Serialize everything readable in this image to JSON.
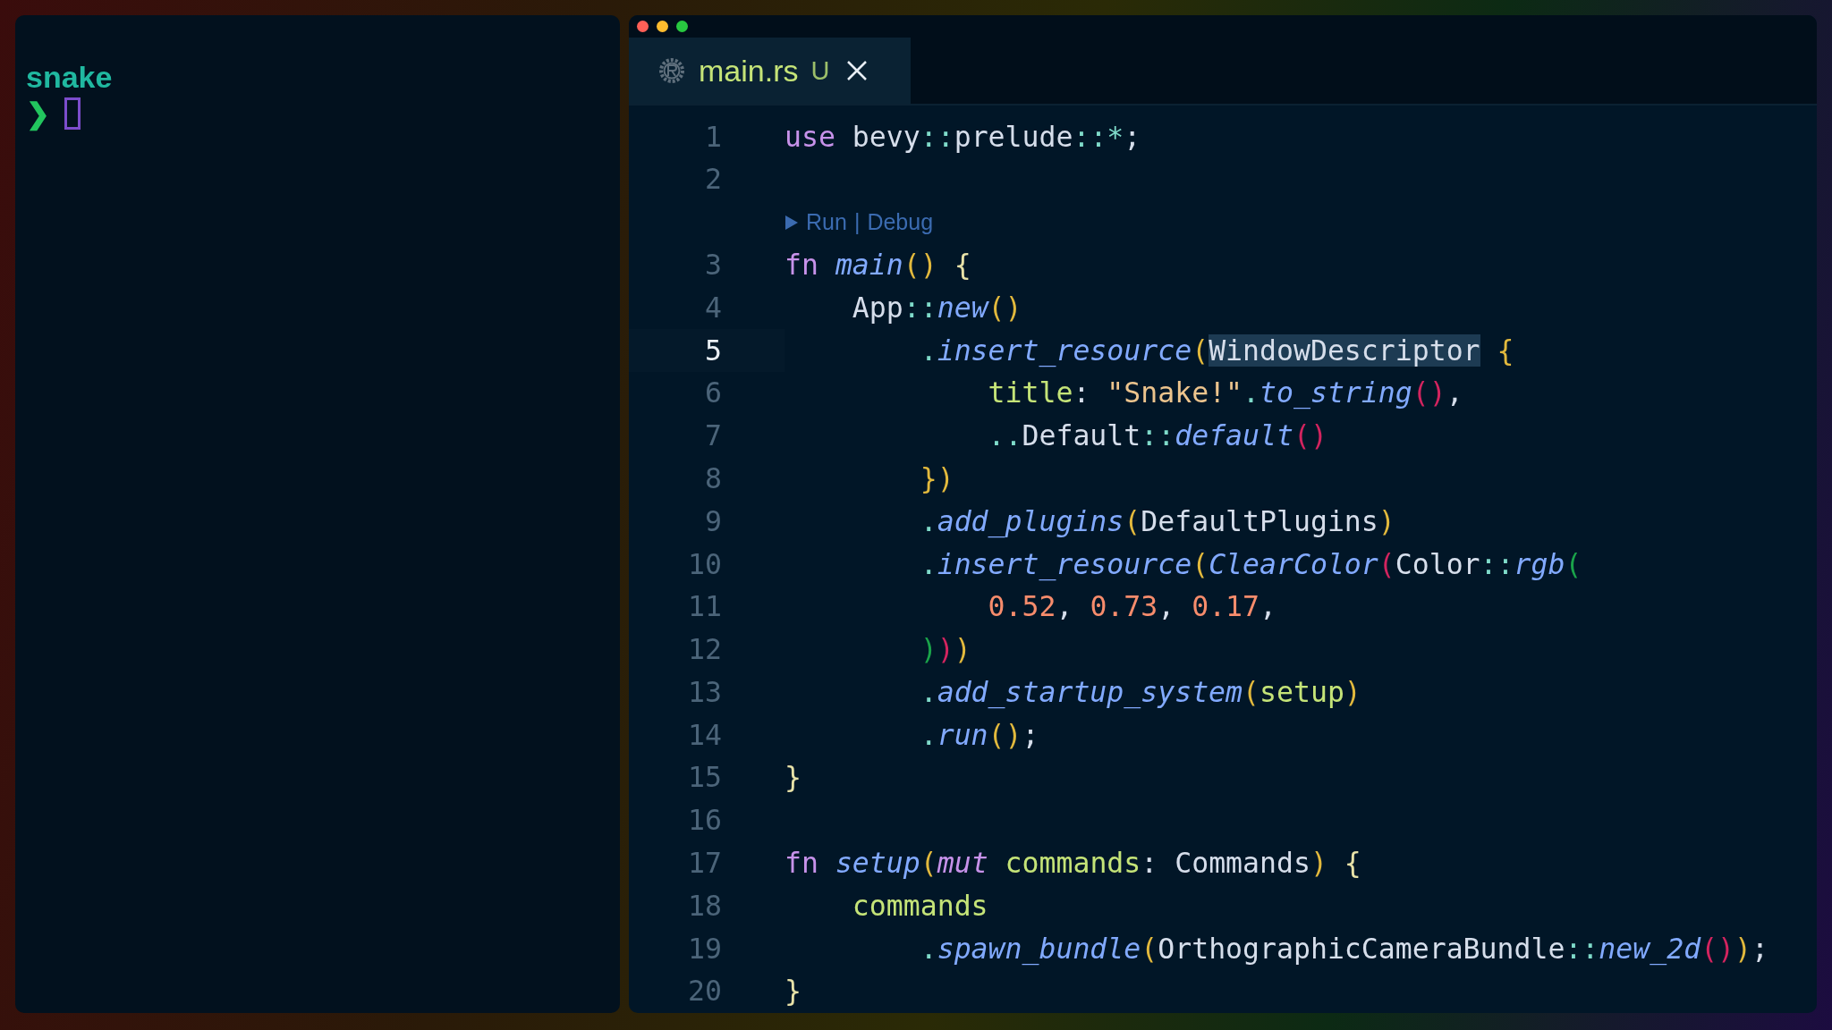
{
  "terminal": {
    "directory": "snake",
    "prompt": "❯"
  },
  "editor": {
    "tabs": [
      {
        "label": "main.rs",
        "status": "U",
        "selected": true
      }
    ],
    "lines": [
      {
        "kind": "code",
        "number": "1",
        "current": false,
        "tokens": [
          {
            "kind": "keyword",
            "text": "use"
          },
          {
            "kind": "plain",
            "text": " bevy"
          },
          {
            "kind": "punct",
            "text": "::"
          },
          {
            "kind": "plain",
            "text": "prelude"
          },
          {
            "kind": "punct",
            "text": "::*"
          },
          {
            "kind": "plain",
            "text": ";"
          }
        ]
      },
      {
        "kind": "code",
        "number": "2",
        "current": false
      },
      {
        "kind": "codelens",
        "run": "Run",
        "separator": "|",
        "debug": "Debug"
      },
      {
        "kind": "code",
        "number": "3",
        "current": false,
        "tokens": [
          {
            "kind": "keyword",
            "text": "fn "
          },
          {
            "kind": "function",
            "text": "main"
          },
          {
            "kind": "paren1",
            "text": "()"
          },
          {
            "kind": "brace",
            "text": " {"
          }
        ]
      },
      {
        "kind": "code",
        "number": "4",
        "current": false,
        "tokens": [
          {
            "kind": "plain",
            "text": "    App"
          },
          {
            "kind": "punct",
            "text": "::"
          },
          {
            "kind": "function",
            "text": "new"
          },
          {
            "kind": "paren1",
            "text": "()"
          }
        ]
      },
      {
        "kind": "code",
        "number": "5",
        "current": true,
        "tokens": [
          {
            "kind": "punct",
            "text": "        ."
          },
          {
            "kind": "function",
            "text": "insert_resource"
          },
          {
            "kind": "paren1",
            "text": "("
          },
          {
            "kind": "selection",
            "text": "WindowDescriptor"
          },
          {
            "kind": "paren1",
            "text": " {"
          }
        ]
      },
      {
        "kind": "code",
        "number": "6",
        "current": false,
        "tokens": [
          {
            "kind": "variable",
            "text": "            title"
          },
          {
            "kind": "plain",
            "text": ": "
          },
          {
            "kind": "string",
            "text": "\"Snake!\""
          },
          {
            "kind": "punct",
            "text": "."
          },
          {
            "kind": "function",
            "text": "to_string"
          },
          {
            "kind": "paren2",
            "text": "()"
          },
          {
            "kind": "plain",
            "text": ","
          }
        ]
      },
      {
        "kind": "code",
        "number": "7",
        "current": false,
        "tokens": [
          {
            "kind": "punct",
            "text": "            .."
          },
          {
            "kind": "plain",
            "text": "Default"
          },
          {
            "kind": "punct",
            "text": "::"
          },
          {
            "kind": "function",
            "text": "default"
          },
          {
            "kind": "paren2",
            "text": "()"
          }
        ]
      },
      {
        "kind": "code",
        "number": "8",
        "current": false,
        "tokens": [
          {
            "kind": "paren1",
            "text": "        })"
          }
        ]
      },
      {
        "kind": "code",
        "number": "9",
        "current": false,
        "tokens": [
          {
            "kind": "punct",
            "text": "        ."
          },
          {
            "kind": "function",
            "text": "add_plugins"
          },
          {
            "kind": "paren1",
            "text": "("
          },
          {
            "kind": "plain",
            "text": "DefaultPlugins"
          },
          {
            "kind": "paren1",
            "text": ")"
          }
        ]
      },
      {
        "kind": "code",
        "number": "10",
        "current": false,
        "tokens": [
          {
            "kind": "punct",
            "text": "        ."
          },
          {
            "kind": "function",
            "text": "insert_resource"
          },
          {
            "kind": "paren1",
            "text": "("
          },
          {
            "kind": "function",
            "text": "ClearColor"
          },
          {
            "kind": "paren2",
            "text": "("
          },
          {
            "kind": "plain",
            "text": "Color"
          },
          {
            "kind": "punct",
            "text": "::"
          },
          {
            "kind": "function",
            "text": "rgb"
          },
          {
            "kind": "paren3",
            "text": "("
          }
        ]
      },
      {
        "kind": "code",
        "number": "11",
        "current": false,
        "tokens": [
          {
            "kind": "number",
            "text": "            0.52"
          },
          {
            "kind": "plain",
            "text": ", "
          },
          {
            "kind": "number",
            "text": "0.73"
          },
          {
            "kind": "plain",
            "text": ", "
          },
          {
            "kind": "number",
            "text": "0.17"
          },
          {
            "kind": "plain",
            "text": ","
          }
        ]
      },
      {
        "kind": "code",
        "number": "12",
        "current": false,
        "tokens": [
          {
            "kind": "paren3",
            "text": "        )"
          },
          {
            "kind": "paren2",
            "text": ")"
          },
          {
            "kind": "paren1",
            "text": ")"
          }
        ]
      },
      {
        "kind": "code",
        "number": "13",
        "current": false,
        "tokens": [
          {
            "kind": "punct",
            "text": "        ."
          },
          {
            "kind": "function",
            "text": "add_startup_system"
          },
          {
            "kind": "paren1",
            "text": "("
          },
          {
            "kind": "variable",
            "text": "setup"
          },
          {
            "kind": "paren1",
            "text": ")"
          }
        ]
      },
      {
        "kind": "code",
        "number": "14",
        "current": false,
        "tokens": [
          {
            "kind": "punct",
            "text": "        ."
          },
          {
            "kind": "function",
            "text": "run"
          },
          {
            "kind": "paren1",
            "text": "()"
          },
          {
            "kind": "plain",
            "text": ";"
          }
        ]
      },
      {
        "kind": "code",
        "number": "15",
        "current": false,
        "tokens": [
          {
            "kind": "brace",
            "text": "}"
          }
        ]
      },
      {
        "kind": "code",
        "number": "16",
        "current": false
      },
      {
        "kind": "code",
        "number": "17",
        "current": false,
        "tokens": [
          {
            "kind": "keyword",
            "text": "fn "
          },
          {
            "kind": "function",
            "text": "setup"
          },
          {
            "kind": "paren1",
            "text": "("
          },
          {
            "kind": "modifier",
            "text": "mut "
          },
          {
            "kind": "variable",
            "text": "commands"
          },
          {
            "kind": "plain",
            "text": ": Commands"
          },
          {
            "kind": "paren1",
            "text": ")"
          },
          {
            "kind": "brace",
            "text": " {"
          }
        ]
      },
      {
        "kind": "code",
        "number": "18",
        "current": false,
        "tokens": [
          {
            "kind": "variable",
            "text": "    commands"
          }
        ]
      },
      {
        "kind": "code",
        "number": "19",
        "current": false,
        "tokens": [
          {
            "kind": "punct",
            "text": "        ."
          },
          {
            "kind": "function",
            "text": "spawn_bundle"
          },
          {
            "kind": "paren1",
            "text": "("
          },
          {
            "kind": "plain",
            "text": "OrthographicCameraBundle"
          },
          {
            "kind": "punct",
            "text": "::"
          },
          {
            "kind": "function",
            "text": "new_2d"
          },
          {
            "kind": "paren2",
            "text": "()"
          },
          {
            "kind": "paren1",
            "text": ")"
          },
          {
            "kind": "plain",
            "text": ";"
          }
        ]
      },
      {
        "kind": "code",
        "number": "20",
        "current": false,
        "tokens": [
          {
            "kind": "brace",
            "text": "}"
          }
        ]
      }
    ]
  }
}
